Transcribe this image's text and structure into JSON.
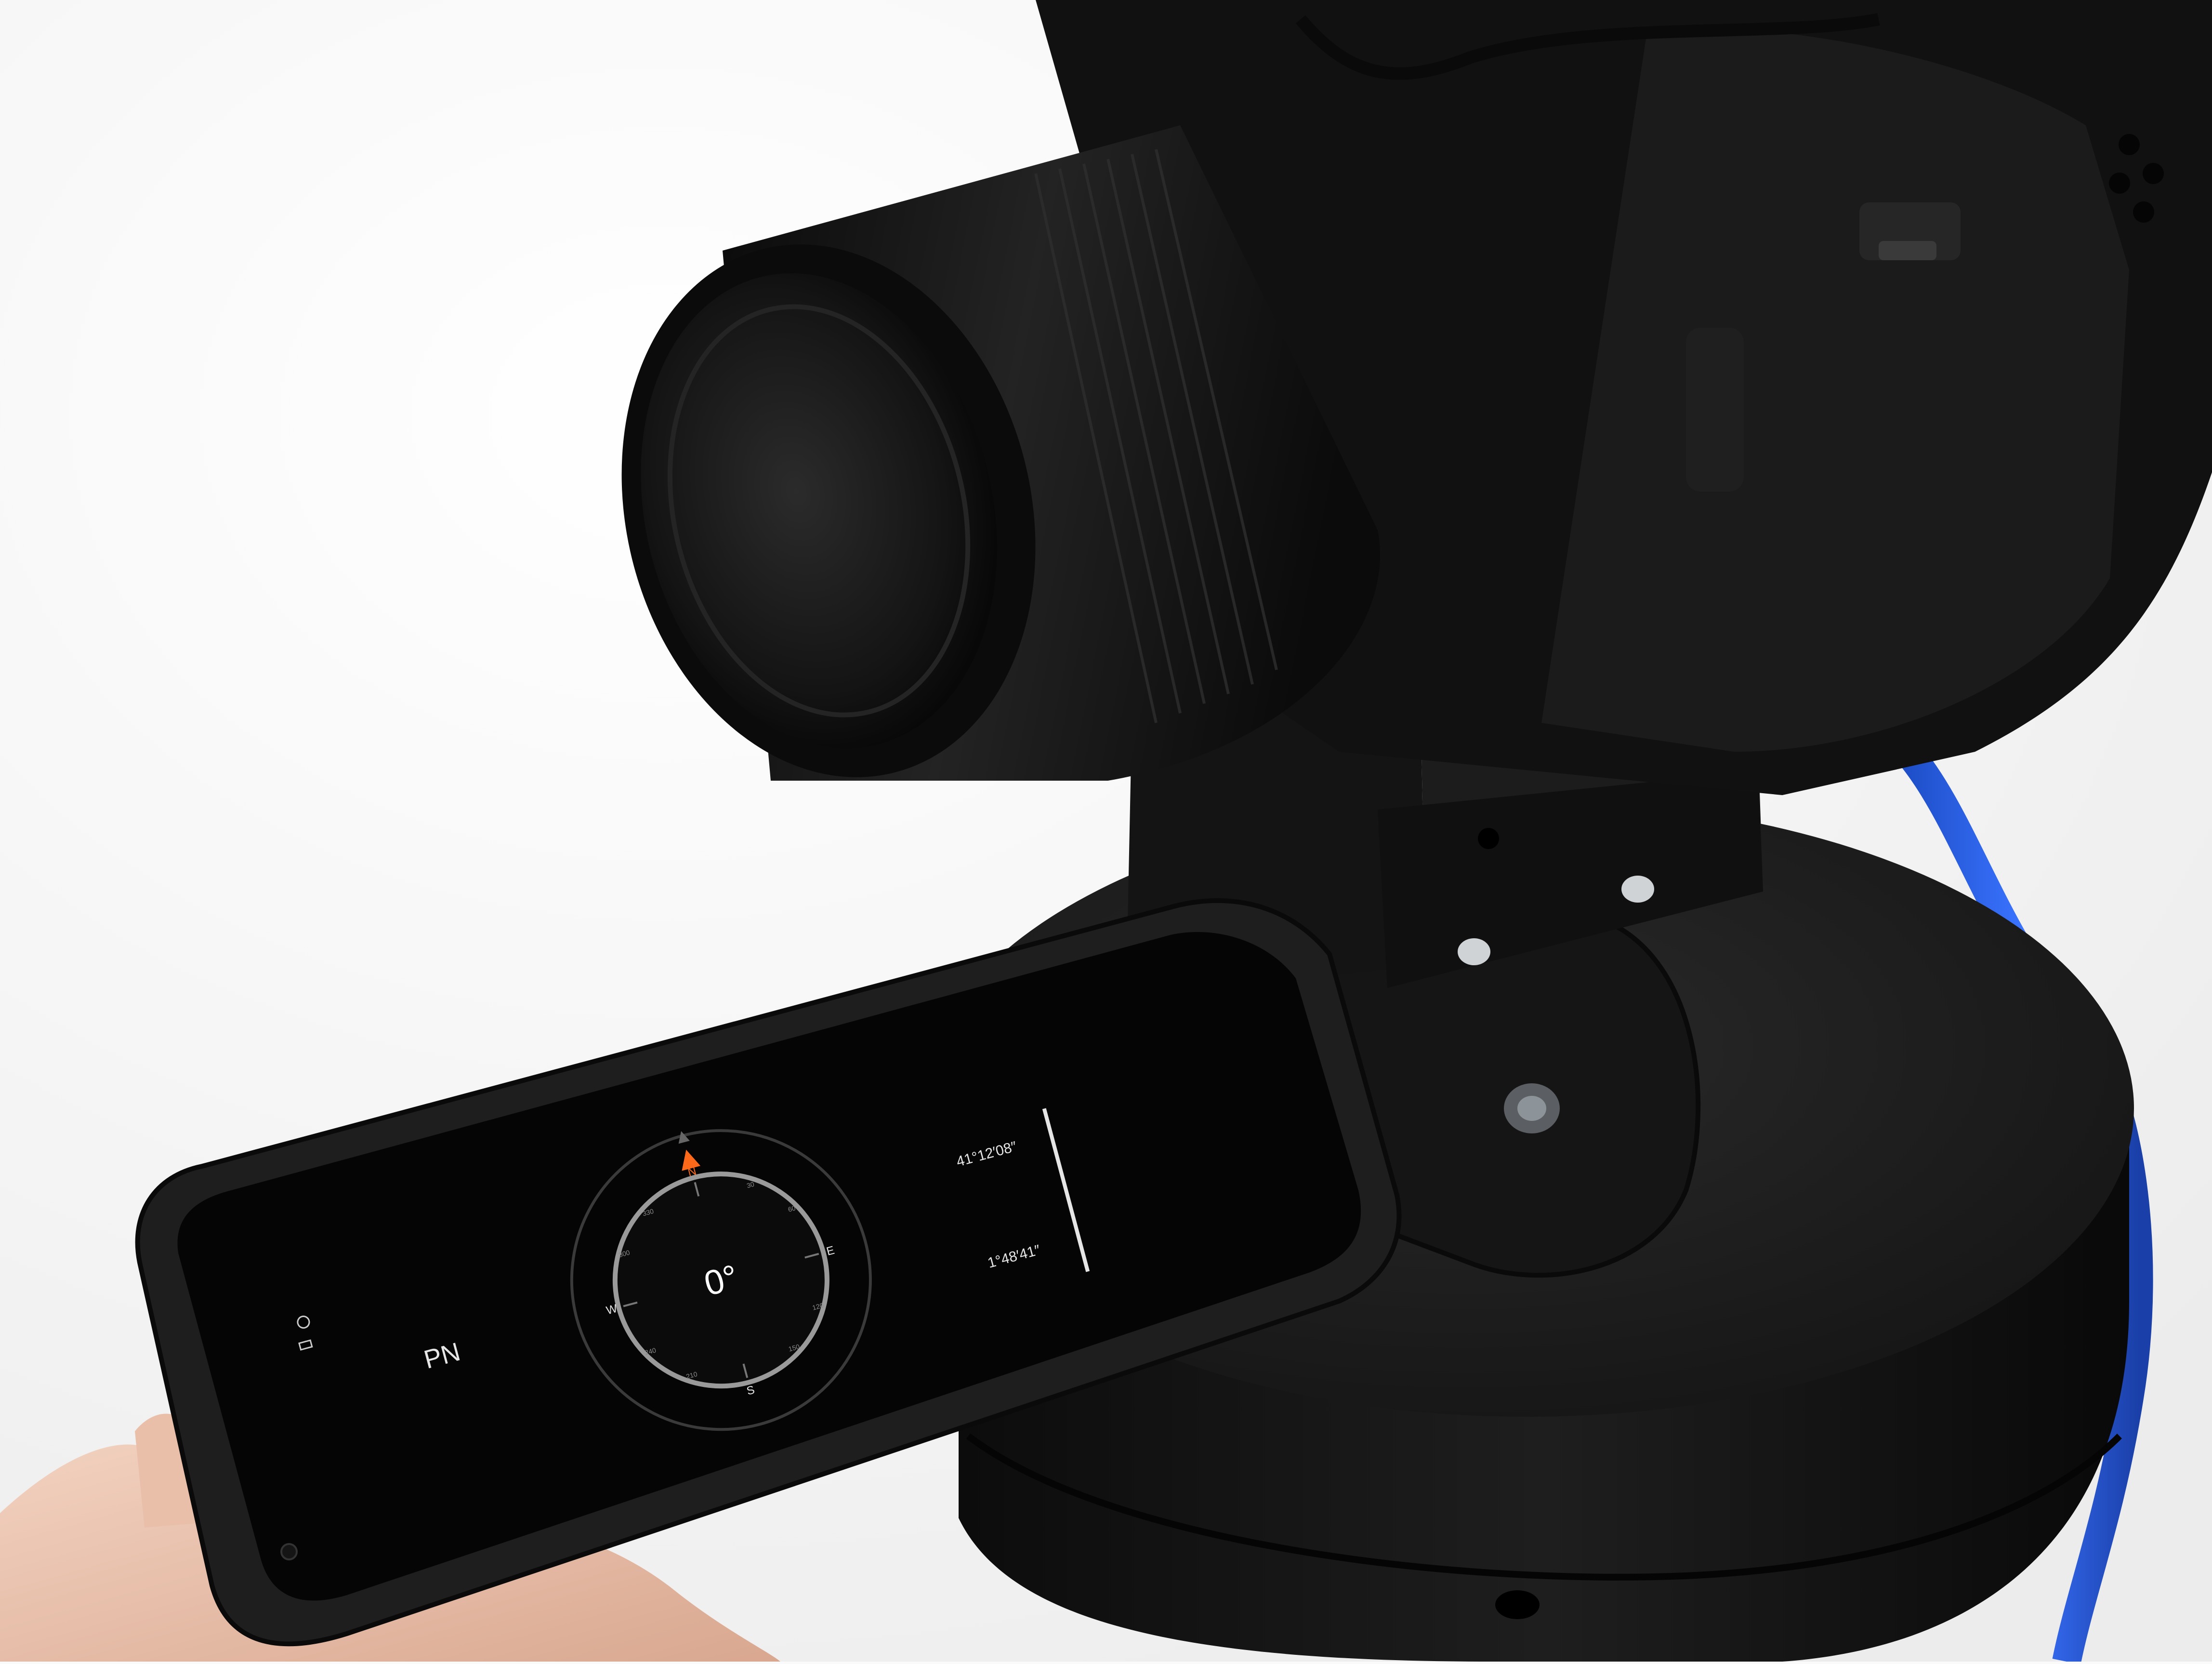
{
  "photo": {
    "background_color": "#fafafa",
    "subjects": [
      "dslr-camera",
      "camera-lens",
      "pan-tilt-mount",
      "turntable-base",
      "smartphone",
      "hand",
      "blue-cable"
    ]
  },
  "phone_screen": {
    "app": "compass",
    "heading": "0°",
    "heading_value_deg": 0,
    "location_label": "PN",
    "cardinal_marks": [
      "N",
      "E",
      "S",
      "W"
    ],
    "degree_ticks": [
      "30",
      "60",
      "120",
      "150",
      "210",
      "240",
      "300",
      "330"
    ],
    "coordinate_lat": "41°12′08″",
    "coordinate_lon": "1°48′41″",
    "accent_color": "#ff6a1a",
    "screen_color": "#050505",
    "text_color": "#e6e6e6"
  }
}
